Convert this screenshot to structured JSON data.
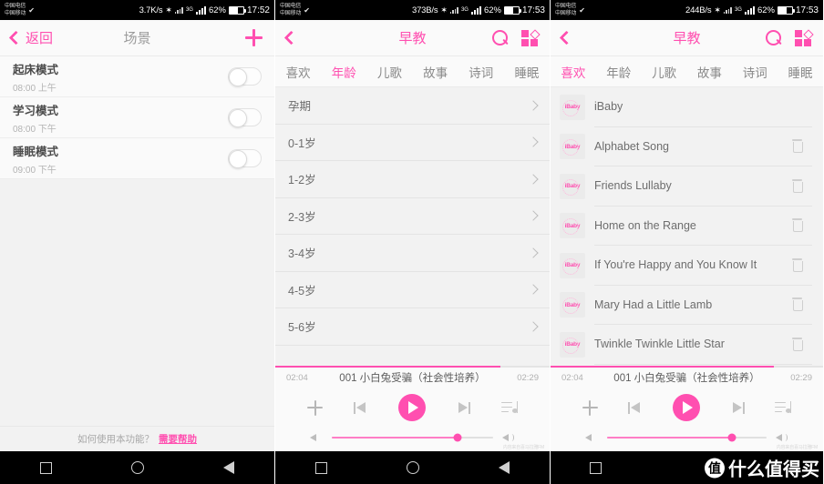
{
  "theme": {
    "accent": "#ff4fb0",
    "accent_light": "#ff7ec6",
    "bg": "#f2f2f2",
    "panel": "#fafafa"
  },
  "panels": [
    {
      "id": "scenes",
      "statusbar": {
        "carrier_line1": "中国电信",
        "carrier_line2": "中国移动",
        "net_speed": "3.7K/s",
        "net_type": "3G",
        "battery": "62%",
        "clock": "17:52"
      },
      "nav": {
        "back_label": "返回",
        "title": "场景",
        "add_icon": "plus-icon"
      },
      "scenes": [
        {
          "name": "起床模式",
          "time": "08:00",
          "meridiem": "上午",
          "enabled": false
        },
        {
          "name": "学习模式",
          "time": "08:00",
          "meridiem": "下午",
          "enabled": false
        },
        {
          "name": "睡眠模式",
          "time": "09:00",
          "meridiem": "下午",
          "enabled": false
        }
      ],
      "help": {
        "question": "如何使用本功能？",
        "link": "需要帮助"
      }
    },
    {
      "id": "age-categories",
      "statusbar": {
        "carrier_line1": "中国电信",
        "carrier_line2": "中国移动",
        "net_speed": "373B/s",
        "net_type": "3G",
        "battery": "62%",
        "clock": "17:53"
      },
      "nav": {
        "title": "早教",
        "search_icon": "search-icon",
        "grid_icon": "grid-icon"
      },
      "tabs": [
        {
          "label": "喜欢",
          "active": false
        },
        {
          "label": "年龄",
          "active": true
        },
        {
          "label": "儿歌",
          "active": false
        },
        {
          "label": "故事",
          "active": false
        },
        {
          "label": "诗词",
          "active": false
        },
        {
          "label": "睡眠",
          "active": false
        }
      ],
      "ages": [
        "孕期",
        "0-1岁",
        "1-2岁",
        "2-3岁",
        "3-4岁",
        "4-5岁",
        "5-6岁"
      ]
    },
    {
      "id": "favorites",
      "statusbar": {
        "carrier_line1": "中国电信",
        "carrier_line2": "中国移动",
        "net_speed": "244B/s",
        "net_type": "3G",
        "battery": "62%",
        "clock": "17:53"
      },
      "nav": {
        "title": "早教",
        "search_icon": "search-icon",
        "grid_icon": "grid-icon"
      },
      "tabs": [
        {
          "label": "喜欢",
          "active": true
        },
        {
          "label": "年龄",
          "active": false
        },
        {
          "label": "儿歌",
          "active": false
        },
        {
          "label": "故事",
          "active": false
        },
        {
          "label": "诗词",
          "active": false
        },
        {
          "label": "睡眠",
          "active": false
        }
      ],
      "songs": [
        {
          "title": "iBaby",
          "thumb_label": "iBaby",
          "deletable": false
        },
        {
          "title": "Alphabet Song",
          "thumb_label": "iBaby",
          "deletable": true
        },
        {
          "title": "Friends Lullaby",
          "thumb_label": "iBaby",
          "deletable": true
        },
        {
          "title": "Home on the Range",
          "thumb_label": "iBaby",
          "deletable": true
        },
        {
          "title": "If You're Happy and You Know It",
          "thumb_label": "iBaby",
          "deletable": true
        },
        {
          "title": "Mary Had a Little Lamb",
          "thumb_label": "iBaby",
          "deletable": true
        },
        {
          "title": "Twinkle Twinkle Little Star",
          "thumb_label": "iBaby",
          "deletable": true
        }
      ]
    }
  ],
  "player": {
    "elapsed": "02:04",
    "duration": "02:29",
    "track_title": "001 小白兔受骗（社会性培养）",
    "progress_percent": 82,
    "volume_percent": 78,
    "state": "playing",
    "controls": {
      "add": "add-icon",
      "prev": "previous-track-icon",
      "play": "play-icon",
      "next": "next-track-icon",
      "queue": "playlist-icon"
    },
    "watermark": "内容来自喜马拉雅FM"
  },
  "androidnav": {
    "recent": "square-icon",
    "home": "circle-icon",
    "back": "triangle-back-icon"
  },
  "site_logo": {
    "badge": "值",
    "text": "什么值得买"
  }
}
